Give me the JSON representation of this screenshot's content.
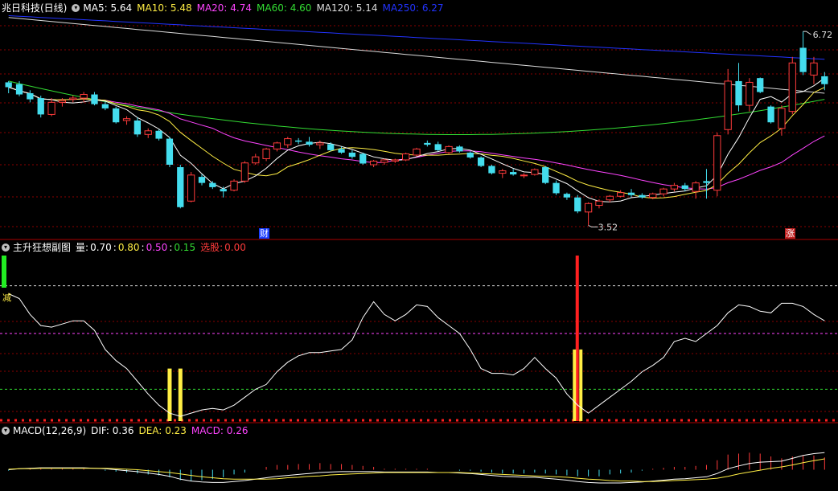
{
  "colors": {
    "background": "#000000",
    "up": "#ff3b3b",
    "down": "#44ddee",
    "ma5": "#ffffff",
    "ma10": "#ffee44",
    "ma20": "#ff44ff",
    "ma60": "#33dd33",
    "ma120": "#dddddd",
    "ma250": "#2233ff",
    "grid_red": "#8a0000"
  },
  "price_panel": {
    "stock_title": "兆日科技(日线)",
    "indicators": [
      {
        "label": "MA5:",
        "value": "5.64",
        "color": "#ffffff"
      },
      {
        "label": "MA10:",
        "value": "5.48",
        "color": "#ffee44"
      },
      {
        "label": "MA20:",
        "value": "4.74",
        "color": "#ff44ff"
      },
      {
        "label": "MA60:",
        "value": "4.60",
        "color": "#33dd33"
      },
      {
        "label": "MA120:",
        "value": "5.14",
        "color": "#dddddd"
      },
      {
        "label": "MA250:",
        "value": "6.27",
        "color": "#2233ff"
      }
    ],
    "high_label": "6.72",
    "low_label": "3.52",
    "badge_cai": "财",
    "badge_zhang": "涨"
  },
  "indicator_panel": {
    "title": "主升狂想副图",
    "items": [
      {
        "text": "量:",
        "color": "#ffffff"
      },
      {
        "text": "0.70",
        "color": "#ffffff"
      },
      {
        "text": ":",
        "color": "#ffffff"
      },
      {
        "text": "0.80",
        "color": "#ffee44"
      },
      {
        "text": ":",
        "color": "#ffffff"
      },
      {
        "text": "0.50",
        "color": "#ff44ff"
      },
      {
        "text": ":",
        "color": "#ffffff"
      },
      {
        "text": "0.15",
        "color": "#33dd33"
      },
      {
        "text": "选股:",
        "color": "#ff3b3b"
      },
      {
        "text": "0.00",
        "color": "#ff3b3b"
      }
    ],
    "side_label": "减"
  },
  "macd_panel": {
    "title": "MACD(12,26,9)",
    "items": [
      {
        "label": "DIF:",
        "value": "0.36",
        "color": "#ffffff"
      },
      {
        "label": "DEA:",
        "value": "0.23",
        "color": "#ffee44"
      },
      {
        "label": "MACD:",
        "value": "0.26",
        "color": "#ff44ff"
      }
    ]
  },
  "chart_data": [
    {
      "type": "candlestick",
      "title": "兆日科技(日线)",
      "ylim": [
        3.3,
        7.0
      ],
      "candles": [
        [
          5.88,
          5.9,
          5.7,
          5.8
        ],
        [
          5.85,
          5.9,
          5.65,
          5.68
        ],
        [
          5.7,
          5.75,
          5.55,
          5.6
        ],
        [
          5.62,
          5.66,
          5.3,
          5.35
        ],
        [
          5.35,
          5.62,
          5.32,
          5.55
        ],
        [
          5.55,
          5.62,
          5.48,
          5.58
        ],
        [
          5.6,
          5.66,
          5.55,
          5.62
        ],
        [
          5.62,
          5.72,
          5.55,
          5.68
        ],
        [
          5.68,
          5.72,
          5.5,
          5.52
        ],
        [
          5.52,
          5.56,
          5.42,
          5.45
        ],
        [
          5.45,
          5.48,
          5.2,
          5.22
        ],
        [
          5.25,
          5.32,
          5.18,
          5.28
        ],
        [
          5.25,
          5.3,
          4.98,
          5.02
        ],
        [
          5.02,
          5.12,
          4.96,
          5.08
        ],
        [
          5.08,
          5.1,
          4.92,
          4.95
        ],
        [
          4.95,
          4.98,
          4.48,
          4.52
        ],
        [
          4.48,
          4.52,
          3.8,
          3.82
        ],
        [
          3.92,
          4.4,
          3.9,
          4.35
        ],
        [
          4.32,
          4.36,
          4.18,
          4.22
        ],
        [
          4.22,
          4.25,
          4.12,
          4.15
        ],
        [
          4.12,
          4.16,
          3.98,
          4.08
        ],
        [
          4.1,
          4.28,
          4.08,
          4.25
        ],
        [
          4.25,
          4.58,
          4.22,
          4.55
        ],
        [
          4.55,
          4.7,
          4.52,
          4.65
        ],
        [
          4.62,
          4.8,
          4.58,
          4.78
        ],
        [
          4.78,
          4.9,
          4.74,
          4.88
        ],
        [
          4.85,
          4.98,
          4.8,
          4.95
        ],
        [
          4.92,
          4.96,
          4.86,
          4.9
        ],
        [
          4.9,
          4.98,
          4.82,
          4.85
        ],
        [
          4.85,
          4.92,
          4.78,
          4.88
        ],
        [
          4.86,
          4.89,
          4.74,
          4.76
        ],
        [
          4.78,
          4.82,
          4.7,
          4.72
        ],
        [
          4.72,
          4.76,
          4.62,
          4.65
        ],
        [
          4.7,
          4.72,
          4.52,
          4.54
        ],
        [
          4.52,
          4.6,
          4.48,
          4.58
        ],
        [
          4.56,
          4.62,
          4.52,
          4.6
        ],
        [
          4.58,
          4.62,
          4.55,
          4.6
        ],
        [
          4.6,
          4.72,
          4.58,
          4.7
        ],
        [
          4.68,
          4.8,
          4.66,
          4.78
        ],
        [
          4.88,
          4.92,
          4.82,
          4.85
        ],
        [
          4.86,
          4.9,
          4.74,
          4.76
        ],
        [
          4.72,
          4.84,
          4.7,
          4.82
        ],
        [
          4.82,
          4.84,
          4.72,
          4.74
        ],
        [
          4.72,
          4.74,
          4.62,
          4.64
        ],
        [
          4.64,
          4.66,
          4.48,
          4.5
        ],
        [
          4.5,
          4.52,
          4.36,
          4.38
        ],
        [
          4.38,
          4.45,
          4.3,
          4.42
        ],
        [
          4.4,
          4.45,
          4.34,
          4.36
        ],
        [
          4.34,
          4.38,
          4.3,
          4.35
        ],
        [
          4.36,
          4.46,
          4.34,
          4.44
        ],
        [
          4.48,
          4.5,
          4.2,
          4.22
        ],
        [
          4.22,
          4.26,
          4.02,
          4.05
        ],
        [
          4.04,
          4.06,
          3.94,
          3.98
        ],
        [
          3.98,
          4.02,
          3.72,
          3.75
        ],
        [
          3.74,
          3.9,
          3.52,
          3.88
        ],
        [
          3.85,
          3.95,
          3.8,
          3.92
        ],
        [
          3.94,
          4.02,
          3.9,
          4.0
        ],
        [
          4.0,
          4.1,
          3.98,
          4.06
        ],
        [
          4.06,
          4.12,
          3.98,
          4.02
        ],
        [
          4.02,
          4.05,
          3.96,
          3.98
        ],
        [
          3.98,
          4.06,
          3.95,
          4.04
        ],
        [
          4.04,
          4.14,
          4.0,
          4.12
        ],
        [
          4.12,
          4.22,
          4.08,
          4.18
        ],
        [
          4.18,
          4.22,
          4.08,
          4.12
        ],
        [
          4.08,
          4.25,
          3.96,
          4.22
        ],
        [
          4.25,
          4.45,
          3.96,
          4.22
        ],
        [
          4.1,
          5.05,
          4.0,
          5.0
        ],
        [
          5.1,
          6.1,
          5.02,
          5.9
        ],
        [
          5.9,
          6.2,
          5.4,
          5.5
        ],
        [
          5.5,
          5.95,
          5.4,
          5.88
        ],
        [
          5.95,
          5.96,
          5.7,
          5.72
        ],
        [
          5.48,
          5.5,
          5.2,
          5.22
        ],
        [
          5.12,
          5.5,
          5.0,
          5.45
        ],
        [
          5.4,
          6.3,
          5.35,
          6.2
        ],
        [
          6.45,
          6.72,
          6.0,
          6.05
        ],
        [
          6.0,
          6.3,
          5.85,
          6.2
        ],
        [
          5.98,
          6.05,
          5.75,
          5.85
        ]
      ]
    },
    {
      "type": "line",
      "title": "主升狂想副图",
      "ylim": [
        -0.05,
        1.0
      ],
      "values": [
        0.75,
        0.72,
        0.62,
        0.55,
        0.54,
        0.56,
        0.58,
        0.58,
        0.52,
        0.4,
        0.33,
        0.28,
        0.2,
        0.12,
        0.05,
        0.0,
        -0.02,
        0.0,
        0.02,
        0.03,
        0.02,
        0.05,
        0.1,
        0.15,
        0.18,
        0.26,
        0.32,
        0.36,
        0.38,
        0.38,
        0.39,
        0.4,
        0.46,
        0.6,
        0.7,
        0.62,
        0.58,
        0.62,
        0.68,
        0.67,
        0.6,
        0.55,
        0.5,
        0.4,
        0.28,
        0.25,
        0.25,
        0.24,
        0.28,
        0.35,
        0.28,
        0.22,
        0.12,
        0.05,
        0.0,
        0.05,
        0.1,
        0.15,
        0.2,
        0.26,
        0.3,
        0.35,
        0.45,
        0.47,
        0.45,
        0.5,
        0.55,
        0.63,
        0.68,
        0.67,
        0.64,
        0.63,
        0.69,
        0.69,
        0.67,
        0.62,
        0.58
      ],
      "signal_bars": [
        15,
        16
      ],
      "signal_bar_colors": [
        "#ffee44",
        "#ffee44"
      ],
      "select_signal_index": 53,
      "reference_lines": [
        0.8,
        0.5,
        0.15
      ]
    },
    {
      "type": "line",
      "title": "MACD(12,26,9)",
      "ylim": [
        -0.45,
        0.45
      ],
      "dif": [
        0.0,
        0.02,
        0.03,
        0.04,
        0.04,
        0.04,
        0.04,
        0.04,
        0.03,
        0.02,
        0.0,
        -0.02,
        -0.04,
        -0.07,
        -0.1,
        -0.14,
        -0.2,
        -0.24,
        -0.26,
        -0.27,
        -0.27,
        -0.25,
        -0.23,
        -0.2,
        -0.17,
        -0.14,
        -0.12,
        -0.1,
        -0.08,
        -0.06,
        -0.05,
        -0.04,
        -0.04,
        -0.04,
        -0.04,
        -0.05,
        -0.05,
        -0.05,
        -0.05,
        -0.05,
        -0.06,
        -0.06,
        -0.07,
        -0.08,
        -0.1,
        -0.12,
        -0.14,
        -0.15,
        -0.16,
        -0.16,
        -0.18,
        -0.2,
        -0.22,
        -0.25,
        -0.27,
        -0.28,
        -0.28,
        -0.28,
        -0.27,
        -0.26,
        -0.24,
        -0.22,
        -0.2,
        -0.19,
        -0.17,
        -0.15,
        -0.08,
        0.02,
        0.08,
        0.13,
        0.16,
        0.17,
        0.18,
        0.24,
        0.3,
        0.34,
        0.36
      ],
      "dea": [
        0.01,
        0.02,
        0.02,
        0.03,
        0.03,
        0.03,
        0.03,
        0.03,
        0.03,
        0.03,
        0.02,
        0.01,
        0.0,
        -0.02,
        -0.04,
        -0.06,
        -0.09,
        -0.12,
        -0.15,
        -0.17,
        -0.19,
        -0.2,
        -0.2,
        -0.2,
        -0.2,
        -0.19,
        -0.17,
        -0.16,
        -0.14,
        -0.13,
        -0.11,
        -0.1,
        -0.09,
        -0.08,
        -0.07,
        -0.06,
        -0.06,
        -0.06,
        -0.06,
        -0.06,
        -0.06,
        -0.06,
        -0.06,
        -0.07,
        -0.08,
        -0.09,
        -0.1,
        -0.11,
        -0.12,
        -0.13,
        -0.14,
        -0.15,
        -0.16,
        -0.18,
        -0.2,
        -0.21,
        -0.23,
        -0.24,
        -0.24,
        -0.25,
        -0.25,
        -0.24,
        -0.23,
        -0.22,
        -0.21,
        -0.2,
        -0.18,
        -0.14,
        -0.09,
        -0.05,
        -0.01,
        0.03,
        0.06,
        0.1,
        0.15,
        0.19,
        0.23
      ]
    }
  ]
}
